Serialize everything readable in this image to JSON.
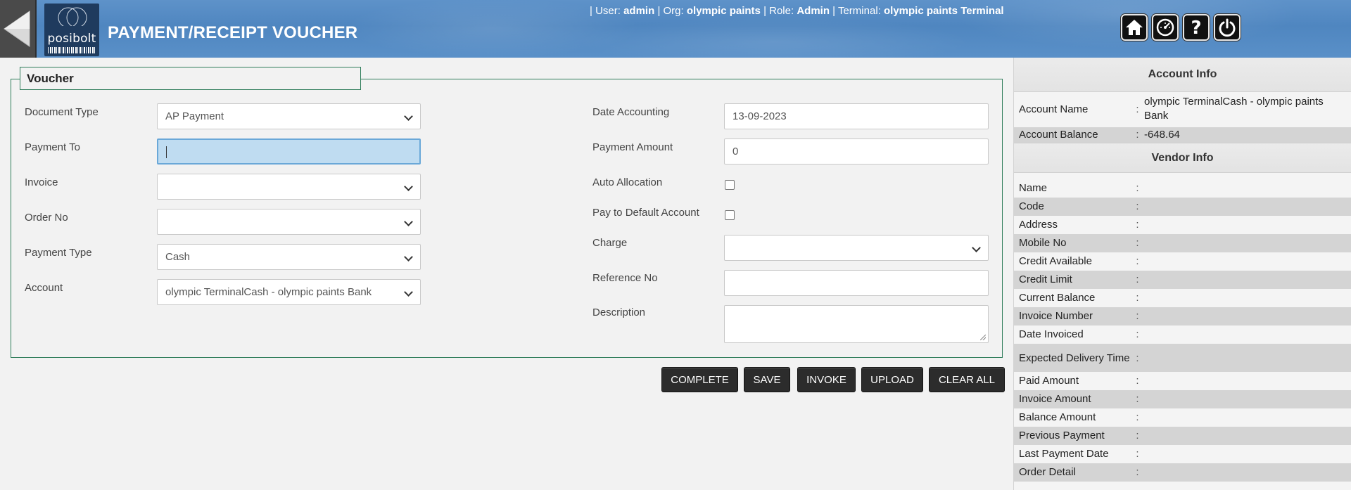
{
  "header": {
    "title": "PAYMENT/RECEIPT VOUCHER",
    "logo_text": "posibolt",
    "user_sep1": "| User:",
    "user": "admin",
    "org_sep": "| Org:",
    "org": "olympic paints",
    "role_sep": "| Role:",
    "role": "Admin",
    "terminal_sep": "| Terminal:",
    "terminal": "olympic paints Terminal",
    "icons": [
      "back-arrow-icon",
      "home-icon",
      "dashboard-gauge-icon",
      "help-icon",
      "power-icon"
    ]
  },
  "voucher": {
    "legend": "Voucher",
    "document_type": {
      "label": "Document Type",
      "value": "AP Payment"
    },
    "payment_to": {
      "label": "Payment To",
      "value": ""
    },
    "invoice": {
      "label": "Invoice",
      "value": ""
    },
    "order_no": {
      "label": "Order No",
      "value": ""
    },
    "payment_type": {
      "label": "Payment Type",
      "value": "Cash"
    },
    "account": {
      "label": "Account",
      "value": "olympic TerminalCash - olympic paints Bank"
    },
    "date_accounting": {
      "label": "Date Accounting",
      "value": "13-09-2023"
    },
    "payment_amount": {
      "label": "Payment Amount",
      "value": "0"
    },
    "auto_allocation": {
      "label": "Auto Allocation",
      "checked": false
    },
    "pay_default": {
      "label": "Pay to Default Account",
      "checked": false
    },
    "charge": {
      "label": "Charge",
      "value": ""
    },
    "reference_no": {
      "label": "Reference No",
      "value": ""
    },
    "description": {
      "label": "Description",
      "value": ""
    }
  },
  "buttons": {
    "complete": "COMPLETE",
    "save": "SAVE",
    "invoke": "INVOKE",
    "upload": "UPLOAD",
    "clear_all": "CLEAR ALL"
  },
  "account_info": {
    "title": "Account Info",
    "account_name_label": "Account Name",
    "account_name": "olympic TerminalCash - olympic paints Bank",
    "account_balance_label": "Account Balance",
    "account_balance": "-648.64"
  },
  "vendor_info": {
    "title": "Vendor Info",
    "separator": ":",
    "rows": [
      {
        "label": "Name",
        "value": ""
      },
      {
        "label": "Code",
        "value": ""
      },
      {
        "label": "Address",
        "value": ""
      },
      {
        "label": "Mobile No",
        "value": ""
      },
      {
        "label": "Credit Available",
        "value": ""
      },
      {
        "label": "Credit Limit",
        "value": ""
      },
      {
        "label": "Current Balance",
        "value": ""
      },
      {
        "label": "Invoice Number",
        "value": ""
      },
      {
        "label": "Date Invoiced",
        "value": ""
      },
      {
        "label": "Expected Delivery Time",
        "value": ""
      },
      {
        "label": "Paid Amount",
        "value": ""
      },
      {
        "label": "Invoice Amount",
        "value": ""
      },
      {
        "label": "Balance Amount",
        "value": ""
      },
      {
        "label": "Previous Payment",
        "value": ""
      },
      {
        "label": "Last Payment Date",
        "value": ""
      },
      {
        "label": "Order Detail",
        "value": ""
      }
    ]
  }
}
